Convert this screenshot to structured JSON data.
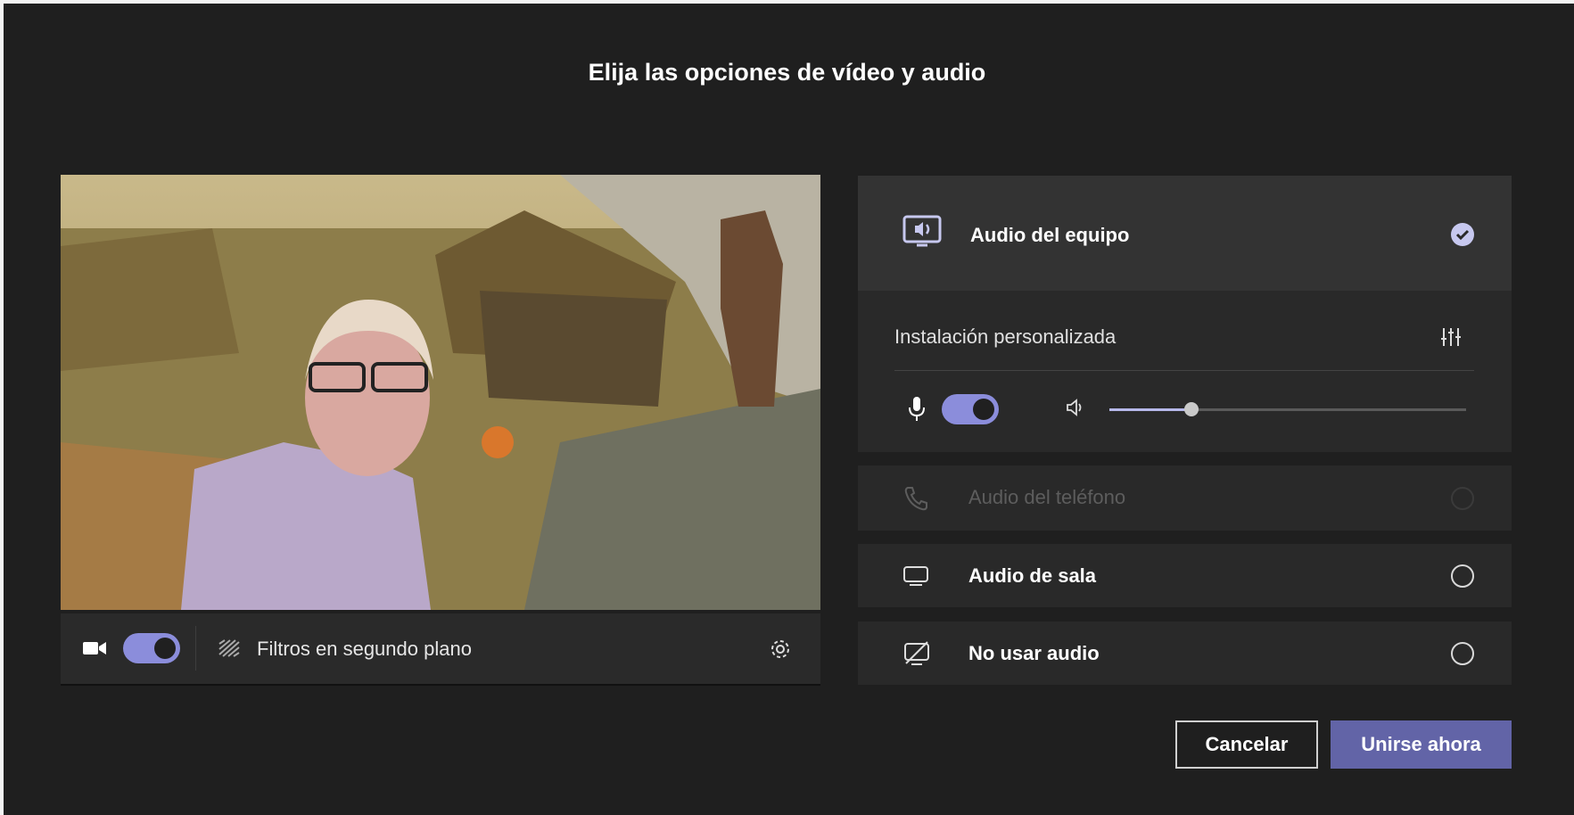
{
  "dialog": {
    "title": "Elija las opciones de vídeo y audio"
  },
  "video": {
    "camera_on": true,
    "filters_label": "Filtros en segundo plano"
  },
  "audio": {
    "computer": {
      "label": "Audio del equipo",
      "selected": true,
      "custom_setup_label": "Instalación personalizada",
      "mic_on": true,
      "speaker_volume": 0.23
    },
    "phone": {
      "label": "Audio del teléfono",
      "disabled": true
    },
    "room": {
      "label": "Audio de sala"
    },
    "none": {
      "label": "No usar audio"
    }
  },
  "buttons": {
    "cancel": "Cancelar",
    "join": "Unirse ahora"
  },
  "colors": {
    "accent": "#6264a7",
    "toggle": "#8b8ddb",
    "background": "#1f1f1f"
  }
}
